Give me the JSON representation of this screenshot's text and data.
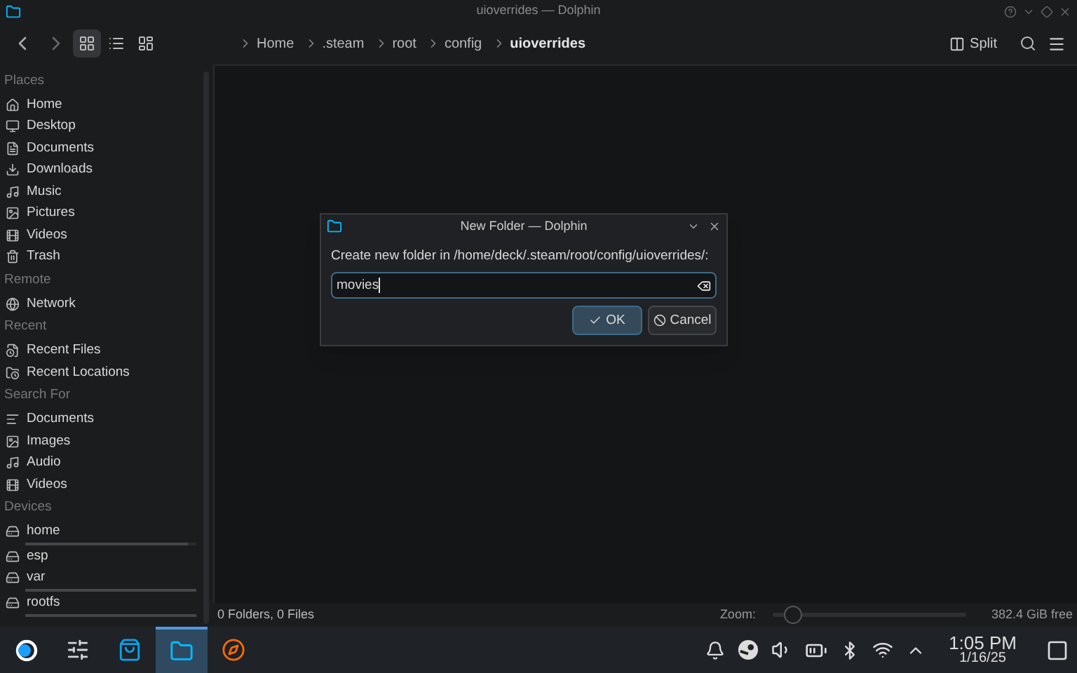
{
  "window": {
    "title": "uioverrides — Dolphin"
  },
  "toolbar": {
    "view_modes": [
      {
        "kind": "icons",
        "selected": true
      },
      {
        "kind": "details",
        "selected": false
      },
      {
        "kind": "compact",
        "selected": false
      }
    ],
    "breadcrumbs": [
      {
        "label": "Home",
        "selected": false
      },
      {
        "label": ".steam",
        "selected": false
      },
      {
        "label": "root",
        "selected": false
      },
      {
        "label": "config",
        "selected": false
      },
      {
        "label": "uioverrides",
        "selected": true
      }
    ],
    "split_label": "Split"
  },
  "sidebar": {
    "sections": [
      {
        "title": "Places",
        "items": [
          {
            "label": "Home",
            "kind": "home"
          },
          {
            "label": "Desktop",
            "kind": "desktop"
          },
          {
            "label": "Documents",
            "kind": "document"
          },
          {
            "label": "Downloads",
            "kind": "download"
          },
          {
            "label": "Music",
            "kind": "music"
          },
          {
            "label": "Pictures",
            "kind": "image"
          },
          {
            "label": "Videos",
            "kind": "video"
          },
          {
            "label": "Trash",
            "kind": "trash"
          }
        ]
      },
      {
        "title": "Remote",
        "items": [
          {
            "label": "Network",
            "kind": "network"
          }
        ]
      },
      {
        "title": "Recent",
        "items": [
          {
            "label": "Recent Files",
            "kind": "recent-file"
          },
          {
            "label": "Recent Locations",
            "kind": "recent-folder"
          }
        ]
      },
      {
        "title": "Search For",
        "items": [
          {
            "label": "Documents",
            "kind": "text"
          },
          {
            "label": "Images",
            "kind": "image"
          },
          {
            "label": "Audio",
            "kind": "music"
          },
          {
            "label": "Videos",
            "kind": "video"
          }
        ]
      },
      {
        "title": "Devices",
        "items": [
          {
            "label": "home",
            "kind": "drive",
            "level": 0.95
          },
          {
            "label": "esp",
            "kind": "drive-warn"
          },
          {
            "label": "var",
            "kind": "drive",
            "level": 1
          },
          {
            "label": "rootfs",
            "kind": "drive-check",
            "level": 1
          }
        ]
      }
    ]
  },
  "status_bar": {
    "summary": "0 Folders, 0 Files",
    "zoom_label": "Zoom:",
    "zoom": {
      "level": 0.1
    },
    "free_space": "382.4 GiB free"
  },
  "dialog": {
    "title": "New Folder — Dolphin",
    "prompt": "Create new folder in /home/deck/.steam/root/config/uioverrides/:",
    "value": "movies",
    "buttons": [
      {
        "label": "OK",
        "kind": "ok",
        "selected": true
      },
      {
        "label": "Cancel",
        "kind": "cancel",
        "selected": false
      }
    ]
  },
  "taskbar": {
    "apps": [
      {
        "kind": "launcher",
        "selected": false
      },
      {
        "kind": "settings",
        "selected": false
      },
      {
        "kind": "store",
        "selected": false
      },
      {
        "kind": "files",
        "selected": true
      },
      {
        "kind": "browser",
        "selected": false
      }
    ],
    "time": "1:05 PM",
    "date": "1/16/25"
  }
}
